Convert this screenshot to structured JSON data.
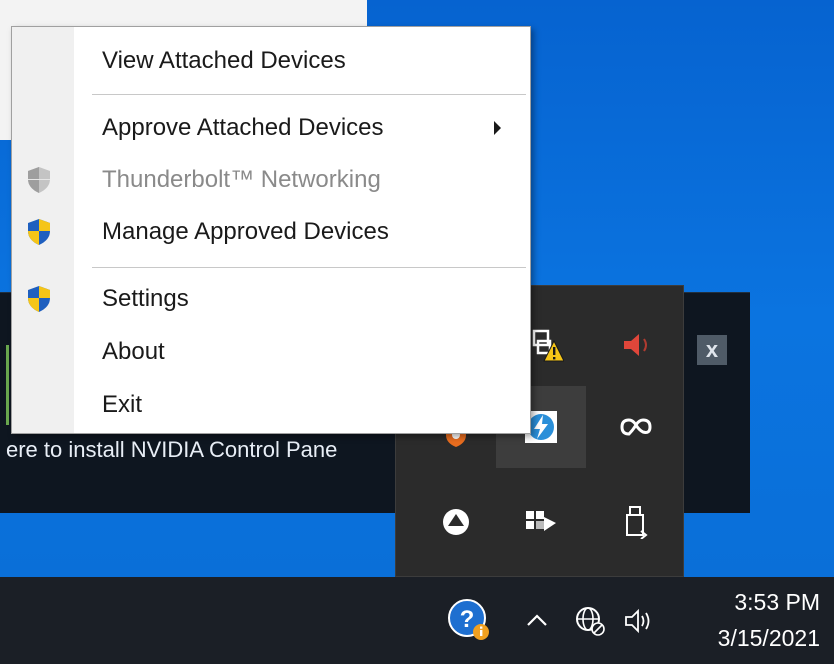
{
  "background_window": {
    "notification_text": "ere to install NVIDIA Control Pane"
  },
  "context_menu": {
    "items": [
      {
        "label": "View Attached Devices",
        "icon": "",
        "enabled": true
      },
      {
        "label": "Approve Attached Devices",
        "icon": "",
        "enabled": true,
        "submenu": true
      },
      {
        "label": "Thunderbolt™ Networking",
        "icon": "shield-gray-icon",
        "enabled": false
      },
      {
        "label": "Manage Approved Devices",
        "icon": "uac-shield-icon",
        "enabled": true
      },
      {
        "label": "Settings",
        "icon": "uac-shield-icon",
        "enabled": true
      },
      {
        "label": "About",
        "icon": "",
        "enabled": true
      },
      {
        "label": "Exit",
        "icon": "",
        "enabled": true
      }
    ]
  },
  "notification": {
    "close_label": "x"
  },
  "tray_flyout": {
    "icons": [
      "network-warning-icon",
      "volume-muted-icon",
      "shield-orange-icon",
      "thunderbolt-icon",
      "creative-cloud-icon",
      "upload-arrow-icon",
      "tile-grid-icon",
      "usb-eject-icon"
    ]
  },
  "taskbar": {
    "tray_icons": [
      "help-icon",
      "chevron-up-icon",
      "network-globe-icon",
      "speaker-icon"
    ],
    "clock": {
      "time": "3:53 PM",
      "date": "3/15/2021"
    }
  },
  "colors": {
    "desktop": "#0a6fd8",
    "taskbar": "#1b1f26",
    "menu_bg": "#ffffff",
    "disabled_text": "#8a8a8a",
    "uac_blue": "#1e5fbf",
    "uac_yellow": "#f5c518"
  }
}
